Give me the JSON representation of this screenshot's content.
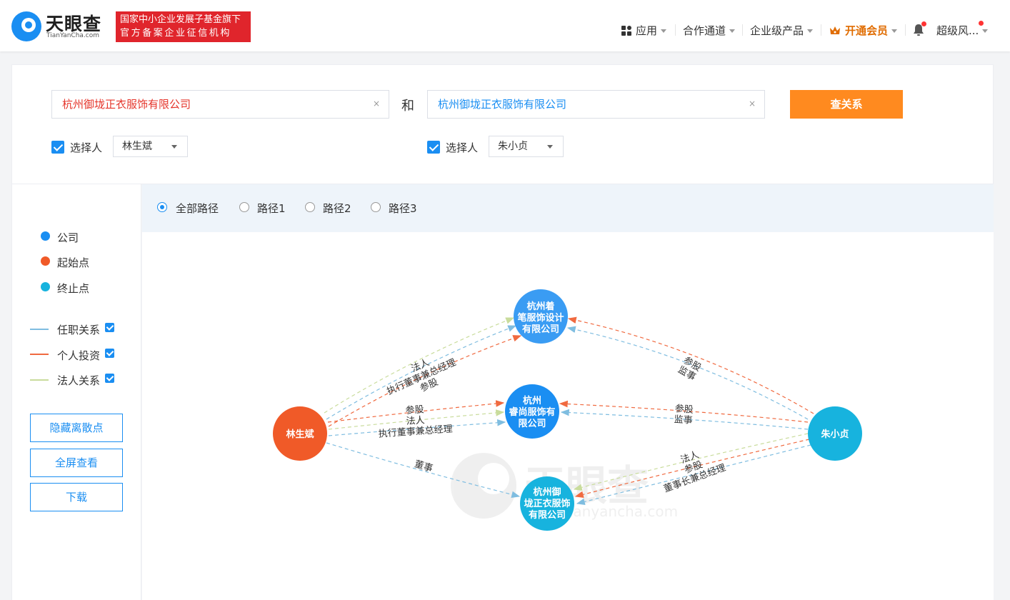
{
  "header": {
    "logo_cn": "天眼查",
    "logo_en": "TianYanCha.com",
    "badge_line1": "国家中小企业发展子基金旗下",
    "badge_line2": "官方备案企业征信机构",
    "nav": {
      "apps": "应用",
      "channel": "合作通道",
      "enterprise": "企业级产品",
      "vip": "开通会员",
      "user": "超级风..."
    }
  },
  "search": {
    "left_company": "杭州御垅正衣服饰有限公司",
    "right_company": "杭州御垅正衣服饰有限公司",
    "and_label": "和",
    "submit": "查关系",
    "left_person_label": "选择人",
    "left_person": "林生斌",
    "right_person_label": "选择人",
    "right_person": "朱小贞",
    "clear": "×"
  },
  "legend": {
    "company": "公司",
    "start": "起始点",
    "end": "终止点",
    "employment": "任职关系",
    "investment": "个人投资",
    "legal": "法人关系",
    "hide_button": "隐藏离散点",
    "fullscreen_button": "全屏查看",
    "download_button": "下载"
  },
  "paths": [
    "全部路径",
    "路径1",
    "路径2",
    "路径3"
  ],
  "colors": {
    "brand_blue": "#1a8ef2",
    "start_node": "#f05a28",
    "end_node": "#17b3de",
    "employment_line": "#7fbde0",
    "investment_line": "#f06a40",
    "legal_line": "#c9dc9c",
    "submit_button": "#ff8a1f",
    "badge_red": "#e0252c"
  },
  "graph": {
    "watermark_cn": "天眼查",
    "watermark_en": "tianyancha.com",
    "nodes": {
      "start": "林生斌",
      "end": "朱小贞",
      "c1": [
        "杭州着",
        "笔服饰设计",
        "有限公司"
      ],
      "c2": [
        "杭州",
        "睿尚服饰有",
        "限公司"
      ],
      "c3": [
        "杭州御",
        "垅正衣服饰",
        "有限公司"
      ]
    },
    "edges": {
      "a_c1": [
        "法人",
        "执行董事兼总经理",
        "参股"
      ],
      "a_c2": [
        "参股",
        "法人",
        "执行董事兼总经理"
      ],
      "a_c3": [
        "董事"
      ],
      "b_c1": [
        "参股",
        "监事"
      ],
      "b_c2": [
        "参股",
        "监事"
      ],
      "b_c3": [
        "法人",
        "参股",
        "董事长兼总经理"
      ]
    }
  }
}
